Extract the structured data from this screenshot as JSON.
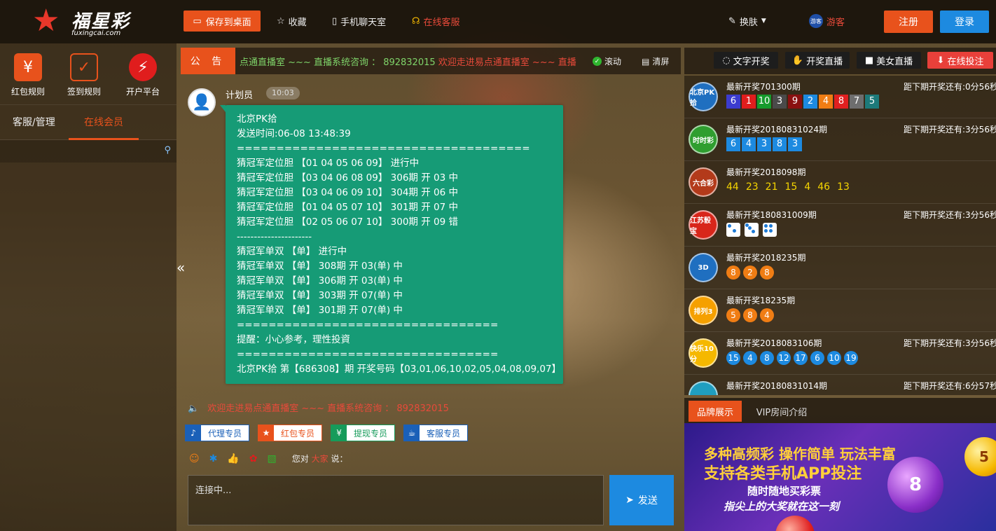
{
  "logo": {
    "brand": "福星彩",
    "domain": "fuxingcai.com"
  },
  "topbar": {
    "save_desktop": "保存到桌面",
    "favorite": "收藏",
    "mobile_chat": "手机聊天室",
    "online_service": "在线客服",
    "skin": "换肤",
    "user": "游客",
    "user_avatar_text": "游客",
    "register": "注册",
    "login": "登录"
  },
  "left": {
    "icons": [
      {
        "label": "红包规则",
        "icon": "red-envelope-icon"
      },
      {
        "label": "签到规则",
        "icon": "calendar-icon"
      },
      {
        "label": "开户平台",
        "icon": "lottery-ball-icon"
      }
    ],
    "tabs": [
      "客服/管理",
      "在线会员"
    ]
  },
  "notice": {
    "label": "公 告",
    "text": "点通直播室 ~~~ 直播系统咨询 ： 892832015    欢迎走进易点通直播室 ~~~ 直播",
    "scroll": "滚动",
    "clear": "清屏"
  },
  "message": {
    "name": "计划员",
    "time": "10:03",
    "lines": [
      "北京PK拾",
      "发送时间:06-08 13:48:39",
      "=====================================",
      "猜冠军定位胆 【01 04 05 06 09】 进行中",
      "猜冠军定位胆 【03 04 06 08 09】 306期 开 03 中",
      "猜冠军定位胆 【03 04 06 09 10】 304期 开 06 中",
      "猜冠军定位胆 【01 04 05 07 10】 301期 开 07 中",
      "猜冠军定位胆 【02 05 06 07 10】 300期 开 09 错",
      "----------------------",
      "猜冠军单双 【单】 进行中",
      "猜冠军单双 【单】 308期 开 03(单) 中",
      "猜冠军单双 【单】 306期 开 03(单) 中",
      "猜冠军单双 【单】 303期 开 07(单) 中",
      "猜冠军单双 【单】 301期 开 07(单) 中",
      "=================================",
      "提醒：小心参考，理性投資",
      "=================================",
      "北京PK拾 第【686308】期 开奖号码【03,01,06,10,02,05,04,08,09,07】"
    ]
  },
  "ticker": "欢迎走进易点通直播室 ~~~ 直播系统咨询 ： 892832015",
  "chips": [
    {
      "label": "代理专员",
      "color": "#1a60b8"
    },
    {
      "label": "红包专员",
      "color": "#e8521c"
    },
    {
      "label": "提现专员",
      "color": "#169b5a"
    },
    {
      "label": "客服专员",
      "color": "#1a60b8"
    }
  ],
  "say": {
    "prefix": "您对",
    "target": "大家",
    "suffix": "说："
  },
  "input": {
    "placeholder": "连接中..."
  },
  "send": "发送",
  "right_tabs": {
    "text_draw": "文字开奖",
    "live_draw": "开奖直播",
    "beauty_live": "美女直播",
    "online_bet": "在线投注"
  },
  "lotteries": [
    {
      "icon": "北京PK拾",
      "color": "#1f6fc0",
      "issue": "最新开奖701300期",
      "countdown": "距下期开奖还有:0分56秒",
      "type": "square",
      "balls": [
        {
          "n": "6",
          "c": "#3c3ccf"
        },
        {
          "n": "1",
          "c": "#e01d1d"
        },
        {
          "n": "10",
          "c": "#169b2d"
        },
        {
          "n": "3",
          "c": "#4a4a4a"
        },
        {
          "n": "9",
          "c": "#8a1010"
        },
        {
          "n": "2",
          "c": "#1d8ae0"
        },
        {
          "n": "4",
          "c": "#f07d14"
        },
        {
          "n": "8",
          "c": "#e02020"
        },
        {
          "n": "7",
          "c": "#6e6e6e"
        },
        {
          "n": "5",
          "c": "#1d7a7a"
        }
      ]
    },
    {
      "icon": "时时彩",
      "color": "#2f9e2f",
      "issue": "最新开奖20180831024期",
      "countdown": "距下期开奖还有:3分56秒",
      "type": "square",
      "balls": [
        {
          "n": "6",
          "c": "#1d8ae0"
        },
        {
          "n": "4",
          "c": "#1d8ae0"
        },
        {
          "n": "3",
          "c": "#1d8ae0"
        },
        {
          "n": "8",
          "c": "#1d8ae0"
        },
        {
          "n": "3",
          "c": "#1d8ae0"
        }
      ]
    },
    {
      "icon": "六合彩",
      "color": "#b33a1a",
      "issue": "最新开奖2018098期",
      "countdown": "",
      "type": "plain",
      "balls": [
        {
          "n": "44",
          "c": "#f5d500"
        },
        {
          "n": "23",
          "c": "#f5d500"
        },
        {
          "n": "21",
          "c": "#f5d500"
        },
        {
          "n": "15",
          "c": "#f5d500"
        },
        {
          "n": "4",
          "c": "#f5d500"
        },
        {
          "n": "46",
          "c": "#f5d500"
        },
        {
          "n": "13",
          "c": "#f5d500"
        }
      ]
    },
    {
      "icon": "江苏骰宝",
      "color": "#d8261a",
      "issue": "最新开奖180831009期",
      "countdown": "距下期开奖还有:3分56秒",
      "type": "dice",
      "balls": [
        {
          "n": "2",
          "c": "#fff"
        },
        {
          "n": "3",
          "c": "#fff"
        },
        {
          "n": "4",
          "c": "#fff"
        }
      ]
    },
    {
      "icon": "3D",
      "color": "#1f6fc0",
      "issue": "最新开奖2018235期",
      "countdown": "",
      "type": "round",
      "balls": [
        {
          "n": "8",
          "c": "#f07d14"
        },
        {
          "n": "2",
          "c": "#f07d14"
        },
        {
          "n": "8",
          "c": "#f07d14"
        }
      ]
    },
    {
      "icon": "排列3",
      "color": "#f5a000",
      "issue": "最新开奖18235期",
      "countdown": "",
      "type": "round",
      "balls": [
        {
          "n": "5",
          "c": "#f07d14"
        },
        {
          "n": "8",
          "c": "#f07d14"
        },
        {
          "n": "4",
          "c": "#f07d14"
        }
      ]
    },
    {
      "icon": "快乐10分",
      "color": "#f5b800",
      "issue": "最新开奖2018083106期",
      "countdown": "距下期开奖还有:3分56秒",
      "type": "round",
      "balls": [
        {
          "n": "15",
          "c": "#1d8ae0"
        },
        {
          "n": "4",
          "c": "#1d8ae0"
        },
        {
          "n": "8",
          "c": "#1d8ae0"
        },
        {
          "n": "12",
          "c": "#1d8ae0"
        },
        {
          "n": "17",
          "c": "#1d8ae0"
        },
        {
          "n": "6",
          "c": "#1d8ae0"
        },
        {
          "n": "10",
          "c": "#1d8ae0"
        },
        {
          "n": "19",
          "c": "#1d8ae0"
        }
      ]
    },
    {
      "icon": "",
      "color": "#1f9ec0",
      "issue": "最新开奖20180831014期",
      "countdown": "距下期开奖还有:6分57秒",
      "type": "round",
      "balls": []
    }
  ],
  "brand_tabs": [
    "品牌展示",
    "VIP房间介绍"
  ],
  "banner": {
    "line1": "多种高频彩 操作简单 玩法丰富",
    "line2": "支持各类手机APP投注",
    "line3": "随时随地买彩票",
    "line4": "指尖上的大奖就在这一刻"
  },
  "colors": {
    "accent": "#e8521c",
    "primary": "#1d8ae0",
    "bubble": "#169b76",
    "notice_green": "#7fd46a",
    "notice_red": "#e84a3a"
  }
}
